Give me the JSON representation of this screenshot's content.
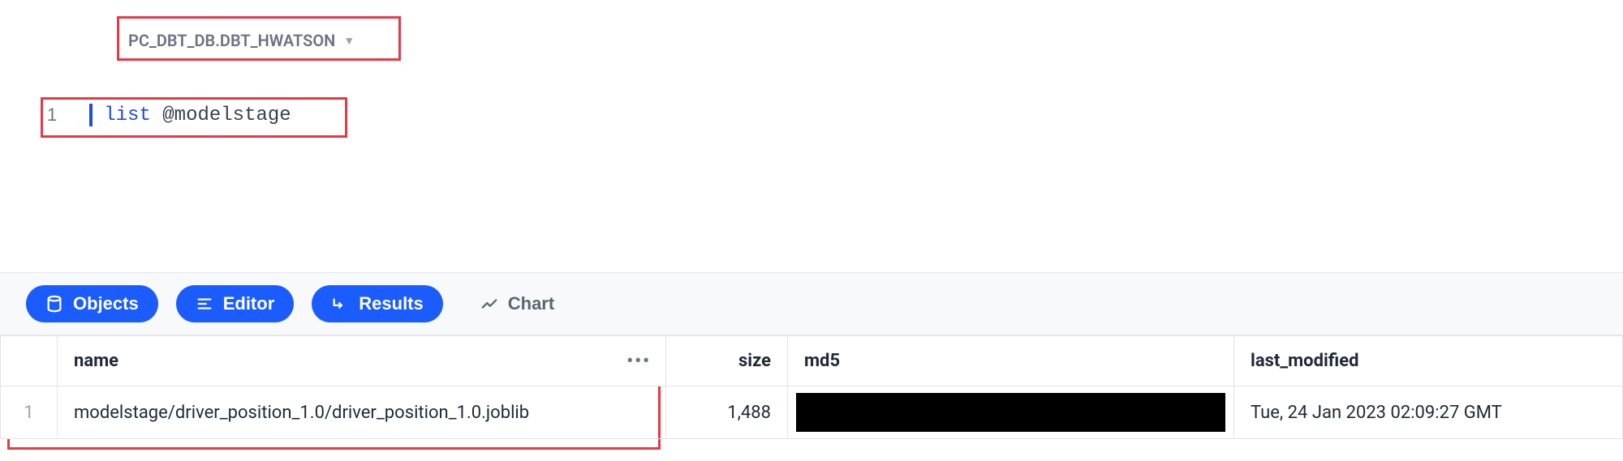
{
  "context": {
    "label": "PC_DBT_DB.DBT_HWATSON"
  },
  "editor": {
    "line_number": "1",
    "keyword": "list",
    "identifier": "@modelstage"
  },
  "buttons": {
    "objects": "Objects",
    "editor": "Editor",
    "results": "Results",
    "chart": "Chart"
  },
  "table": {
    "headers": {
      "name": "name",
      "size": "size",
      "md5": "md5",
      "last_modified": "last_modified"
    },
    "rows": [
      {
        "row_num": "1",
        "name": "modelstage/driver_position_1.0/driver_position_1.0.joblib",
        "size": "1,488",
        "md5": "",
        "last_modified": "Tue, 24 Jan 2023 02:09:27 GMT"
      }
    ]
  }
}
